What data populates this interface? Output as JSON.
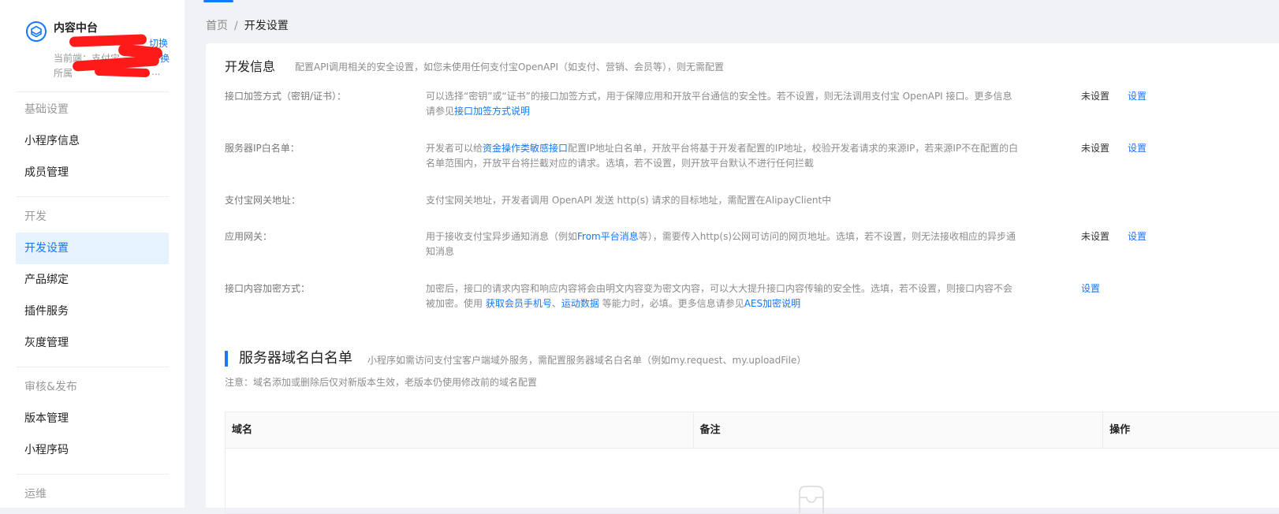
{
  "app": {
    "name": "内容中台",
    "switch_label": "切换",
    "current_prefix": "当前端：",
    "current_value": "支付宝",
    "current_switch": "换",
    "belong_prefix": "所属",
    "belong_ellipsis": "..."
  },
  "sidebar": {
    "groups": [
      {
        "title": "基础设置",
        "items": [
          "小程序信息",
          "成员管理"
        ]
      },
      {
        "title": "开发",
        "items": [
          "开发设置",
          "产品绑定",
          "插件服务",
          "灰度管理"
        ]
      },
      {
        "title": "审核&发布",
        "items": [
          "版本管理",
          "小程序码"
        ]
      },
      {
        "title": "运维",
        "items": []
      }
    ],
    "active_item": "开发设置"
  },
  "breadcrumb": {
    "home": "首页",
    "separator": "/",
    "current": "开发设置"
  },
  "dev_info": {
    "title": "开发信息",
    "desc": "配置API调用相关的安全设置，如您未使用任何支付宝OpenAPI（如支付、营销、会员等），则无需配置",
    "rows": [
      {
        "label": "接口加签方式（密钥/证书）：",
        "desc_text": "可以选择“密钥”或“证书”的接口加签方式，用于保障应用和开放平台通信的安全性。若不设置，则无法调用支付宝 OpenAPI 接口。更多信息请参见",
        "desc_link": "接口加签方式说明",
        "status": "未设置",
        "action": "设置"
      },
      {
        "label": "服务器IP白名单：",
        "desc_pre": "开发者可以给",
        "desc_link": "资金操作类敏感接口",
        "desc_post": "配置IP地址白名单，开放平台将基于开发者配置的IP地址，校验开发者请求的来源IP，若来源IP不在配置的白名单范围内，开放平台将拦截对应的请求。选填，若不设置，则开放平台默认不进行任何拦截",
        "status": "未设置",
        "action": "设置"
      },
      {
        "label": "支付宝网关地址：",
        "desc_text": "支付宝网关地址，开发者调用 OpenAPI 发送 http(s) 请求的目标地址，需配置在AlipayClient中"
      },
      {
        "label": "应用网关：",
        "desc_pre": "用于接收支付宝异步通知消息（例如",
        "desc_link": "From平台消息",
        "desc_post": "等），需要传入http(s)公网可访问的网页地址。选填，若不设置，则无法接收相应的异步通知消息",
        "status": "未设置",
        "action": "设置"
      },
      {
        "label": "接口内容加密方式：",
        "desc_pre": "加密后，接口的请求内容和响应内容将会由明文内容变为密文内容，可以大大提升接口内容传输的安全性。选填，若不设置，则接口内容不会被加密。使用 ",
        "desc_link1": "获取会员手机号",
        "desc_mid": "、",
        "desc_link2": "运动数据",
        "desc_mid2": " 等能力时，必填。更多信息请参见",
        "desc_link3": "AES加密说明",
        "action": "设置"
      }
    ]
  },
  "domain_whitelist": {
    "title": "服务器域名白名单",
    "desc": "小程序如需访问支付宝客户端域外服务，需配置服务器域名白名单（例如my.request、my.uploadFile）",
    "note": "注意：域名添加或删除后仅对新版本生效，老版本仍使用修改前的域名配置",
    "columns": [
      "域名",
      "备注",
      "操作"
    ]
  },
  "colors": {
    "accent": "#1677ff",
    "redaction": "#ff1a1a"
  }
}
